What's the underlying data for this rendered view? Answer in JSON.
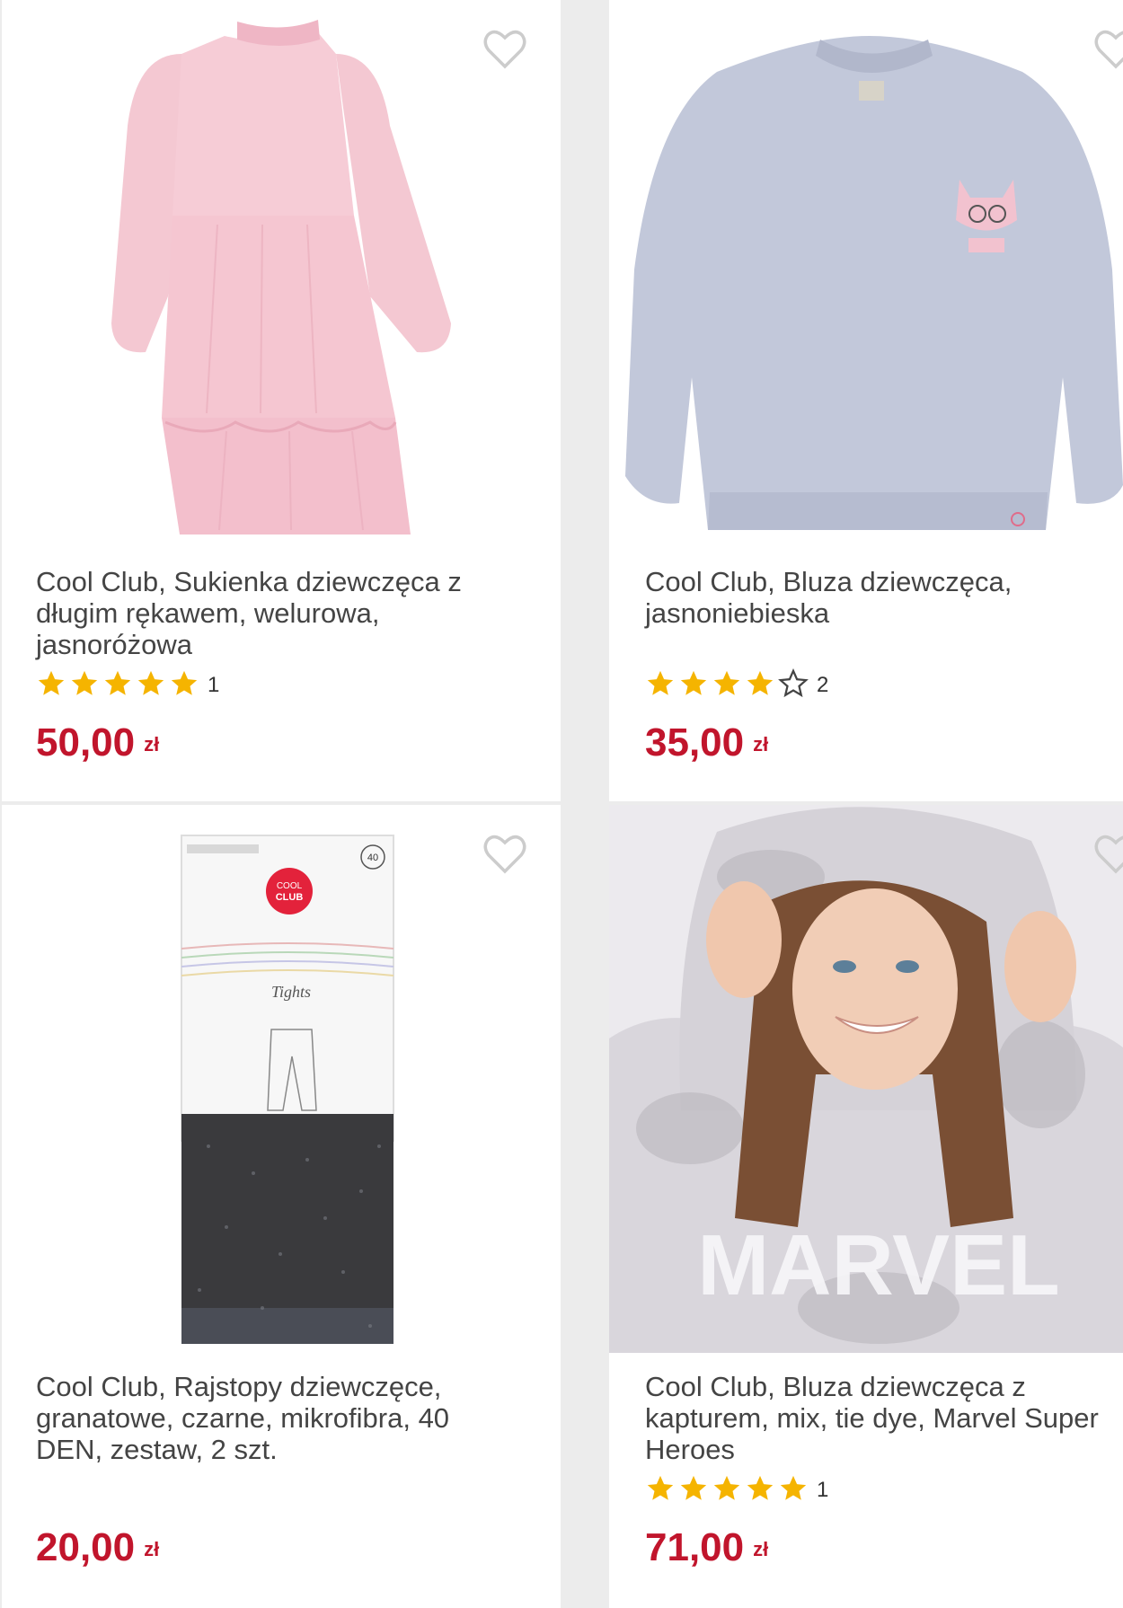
{
  "products": [
    {
      "title": "Cool Club, Sukienka dziewczęca z długim rękawem, welurowa, jasnoróżowa",
      "rating": 5,
      "review_count": "1",
      "price": "50,00",
      "currency": "zł",
      "image": "pink-velour-dress"
    },
    {
      "title": "Cool Club, Bluza dziewczęca, jasnoniebieska",
      "rating": 4,
      "review_count": "2",
      "price": "35,00",
      "currency": "zł",
      "image": "light-blue-sweatshirt"
    },
    {
      "title": "Cool Club, Rajstopy dziewczęce, granatowe, czarne, mikrofibra, 40 DEN, zestaw, 2 szt.",
      "rating": null,
      "review_count": null,
      "price": "20,00",
      "currency": "zł",
      "image": "glitter-tights-package"
    },
    {
      "title": "Cool Club, Bluza dziewczęca z kapturem, mix, tie dye, Marvel Super Heroes",
      "rating": 5,
      "review_count": "1",
      "price": "71,00",
      "currency": "zł",
      "image": "girl-in-tie-dye-hoodie"
    }
  ],
  "package_label": {
    "brand_line1": "COOL",
    "brand_line2": "CLUB",
    "den": "40",
    "product_script": "Tights"
  },
  "colors": {
    "price": "#c1152c",
    "star": "#f5b400",
    "heart_outline": "#cccccc"
  }
}
